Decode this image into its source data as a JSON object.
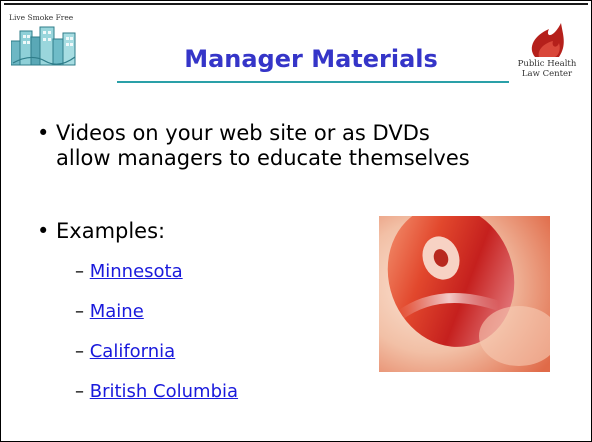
{
  "logo_left": {
    "text": "Live Smoke Free"
  },
  "title": "Manager Materials",
  "logo_right": {
    "line1": "Public Health",
    "line2": "Law Center"
  },
  "bullets": [
    {
      "marker": "•",
      "lines": [
        "Videos on your web site or as DVDs",
        "allow managers to educate themselves"
      ]
    },
    {
      "marker": "•",
      "lines": [
        "Examples:"
      ]
    }
  ],
  "examples": {
    "dash": "–",
    "items": [
      "Minnesota",
      "Maine",
      "California",
      "British Columbia"
    ]
  },
  "colors": {
    "title": "#3535c8",
    "link": "#1a1adc",
    "rule": "#2aa0a8",
    "logo_red": "#b5201b"
  },
  "photo": {
    "subject": "dvd-disc-photo"
  }
}
